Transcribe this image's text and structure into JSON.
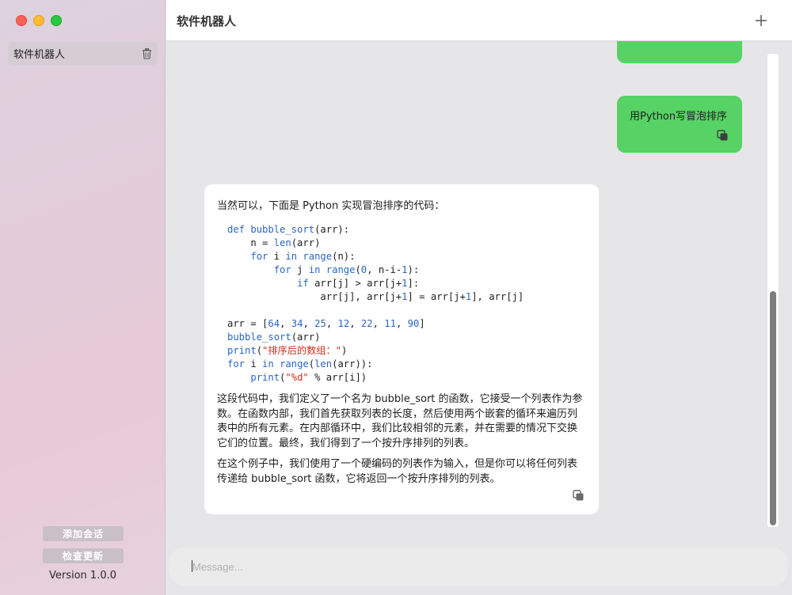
{
  "sidebar": {
    "conversations": [
      {
        "label": "软件机器人"
      }
    ],
    "add_conversation": "添加会话",
    "check_update": "检查更新",
    "version": "Version 1.0.0"
  },
  "header": {
    "title": "软件机器人"
  },
  "messages": {
    "user": {
      "text": "用Python写冒泡排序"
    },
    "bot": {
      "intro": "当然可以，下面是 Python 实现冒泡排序的代码：",
      "code_lines": [
        "def bubble_sort(arr):",
        "    n = len(arr)",
        "    for i in range(n):",
        "        for j in range(0, n-i-1):",
        "            if arr[j] > arr[j+1]:",
        "                arr[j], arr[j+1] = arr[j+1], arr[j]",
        "",
        "arr = [64, 34, 25, 12, 22, 11, 90]",
        "bubble_sort(arr)",
        "print(\"排序后的数组：\")",
        "for i in range(len(arr)):",
        "    print(\"%d\" % arr[i])"
      ],
      "para1": "这段代码中，我们定义了一个名为 bubble_sort 的函数，它接受一个列表作为参数。在函数内部，我们首先获取列表的长度，然后使用两个嵌套的循环来遍历列表中的所有元素。在内部循环中，我们比较相邻的元素，并在需要的情况下交换它们的位置。最终，我们得到了一个按升序排列的列表。",
      "para2": "在这个例子中，我们使用了一个硬编码的列表作为输入，但是你可以将任何列表传递给 bubble_sort 函数，它将返回一个按升序排列的列表。"
    }
  },
  "input": {
    "placeholder": "Message..."
  },
  "colors": {
    "user_bubble": "#56d364",
    "keyword": "#2a66c4",
    "string": "#d12f1b"
  },
  "icons": [
    "trash-icon",
    "plus-icon",
    "copy-icon"
  ]
}
